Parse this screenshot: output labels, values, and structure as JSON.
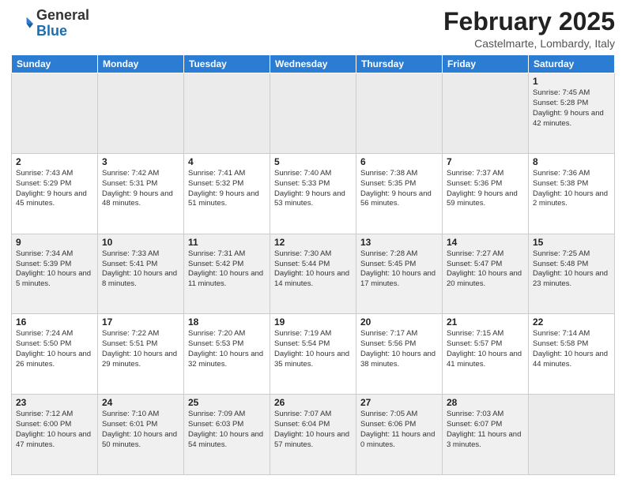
{
  "logo": {
    "general": "General",
    "blue": "Blue"
  },
  "title": "February 2025",
  "subtitle": "Castelmarte, Lombardy, Italy",
  "weekdays": [
    "Sunday",
    "Monday",
    "Tuesday",
    "Wednesday",
    "Thursday",
    "Friday",
    "Saturday"
  ],
  "weeks": [
    [
      {
        "day": null,
        "info": null
      },
      {
        "day": null,
        "info": null
      },
      {
        "day": null,
        "info": null
      },
      {
        "day": null,
        "info": null
      },
      {
        "day": null,
        "info": null
      },
      {
        "day": null,
        "info": null
      },
      {
        "day": "1",
        "info": "Sunrise: 7:45 AM\nSunset: 5:28 PM\nDaylight: 9 hours\nand 42 minutes."
      }
    ],
    [
      {
        "day": "2",
        "info": "Sunrise: 7:43 AM\nSunset: 5:29 PM\nDaylight: 9 hours\nand 45 minutes."
      },
      {
        "day": "3",
        "info": "Sunrise: 7:42 AM\nSunset: 5:31 PM\nDaylight: 9 hours\nand 48 minutes."
      },
      {
        "day": "4",
        "info": "Sunrise: 7:41 AM\nSunset: 5:32 PM\nDaylight: 9 hours\nand 51 minutes."
      },
      {
        "day": "5",
        "info": "Sunrise: 7:40 AM\nSunset: 5:33 PM\nDaylight: 9 hours\nand 53 minutes."
      },
      {
        "day": "6",
        "info": "Sunrise: 7:38 AM\nSunset: 5:35 PM\nDaylight: 9 hours\nand 56 minutes."
      },
      {
        "day": "7",
        "info": "Sunrise: 7:37 AM\nSunset: 5:36 PM\nDaylight: 9 hours\nand 59 minutes."
      },
      {
        "day": "8",
        "info": "Sunrise: 7:36 AM\nSunset: 5:38 PM\nDaylight: 10 hours\nand 2 minutes."
      }
    ],
    [
      {
        "day": "9",
        "info": "Sunrise: 7:34 AM\nSunset: 5:39 PM\nDaylight: 10 hours\nand 5 minutes."
      },
      {
        "day": "10",
        "info": "Sunrise: 7:33 AM\nSunset: 5:41 PM\nDaylight: 10 hours\nand 8 minutes."
      },
      {
        "day": "11",
        "info": "Sunrise: 7:31 AM\nSunset: 5:42 PM\nDaylight: 10 hours\nand 11 minutes."
      },
      {
        "day": "12",
        "info": "Sunrise: 7:30 AM\nSunset: 5:44 PM\nDaylight: 10 hours\nand 14 minutes."
      },
      {
        "day": "13",
        "info": "Sunrise: 7:28 AM\nSunset: 5:45 PM\nDaylight: 10 hours\nand 17 minutes."
      },
      {
        "day": "14",
        "info": "Sunrise: 7:27 AM\nSunset: 5:47 PM\nDaylight: 10 hours\nand 20 minutes."
      },
      {
        "day": "15",
        "info": "Sunrise: 7:25 AM\nSunset: 5:48 PM\nDaylight: 10 hours\nand 23 minutes."
      }
    ],
    [
      {
        "day": "16",
        "info": "Sunrise: 7:24 AM\nSunset: 5:50 PM\nDaylight: 10 hours\nand 26 minutes."
      },
      {
        "day": "17",
        "info": "Sunrise: 7:22 AM\nSunset: 5:51 PM\nDaylight: 10 hours\nand 29 minutes."
      },
      {
        "day": "18",
        "info": "Sunrise: 7:20 AM\nSunset: 5:53 PM\nDaylight: 10 hours\nand 32 minutes."
      },
      {
        "day": "19",
        "info": "Sunrise: 7:19 AM\nSunset: 5:54 PM\nDaylight: 10 hours\nand 35 minutes."
      },
      {
        "day": "20",
        "info": "Sunrise: 7:17 AM\nSunset: 5:56 PM\nDaylight: 10 hours\nand 38 minutes."
      },
      {
        "day": "21",
        "info": "Sunrise: 7:15 AM\nSunset: 5:57 PM\nDaylight: 10 hours\nand 41 minutes."
      },
      {
        "day": "22",
        "info": "Sunrise: 7:14 AM\nSunset: 5:58 PM\nDaylight: 10 hours\nand 44 minutes."
      }
    ],
    [
      {
        "day": "23",
        "info": "Sunrise: 7:12 AM\nSunset: 6:00 PM\nDaylight: 10 hours\nand 47 minutes."
      },
      {
        "day": "24",
        "info": "Sunrise: 7:10 AM\nSunset: 6:01 PM\nDaylight: 10 hours\nand 50 minutes."
      },
      {
        "day": "25",
        "info": "Sunrise: 7:09 AM\nSunset: 6:03 PM\nDaylight: 10 hours\nand 54 minutes."
      },
      {
        "day": "26",
        "info": "Sunrise: 7:07 AM\nSunset: 6:04 PM\nDaylight: 10 hours\nand 57 minutes."
      },
      {
        "day": "27",
        "info": "Sunrise: 7:05 AM\nSunset: 6:06 PM\nDaylight: 11 hours\nand 0 minutes."
      },
      {
        "day": "28",
        "info": "Sunrise: 7:03 AM\nSunset: 6:07 PM\nDaylight: 11 hours\nand 3 minutes."
      },
      {
        "day": null,
        "info": null
      }
    ]
  ]
}
